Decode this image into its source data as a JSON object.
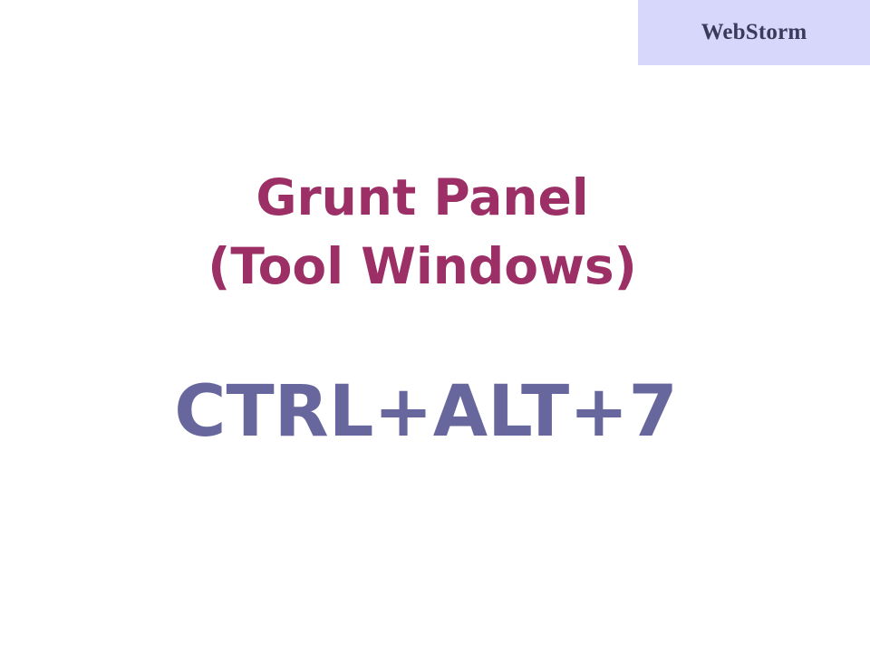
{
  "brand": {
    "label": "WebStorm"
  },
  "slide": {
    "title_line1": "Grunt Panel",
    "title_line2": "(Tool Windows)",
    "shortcut": "CTRL+ALT+7"
  },
  "colors": {
    "brand_background": "#d7d7fb",
    "title": "#9b2f66",
    "shortcut": "#67679e"
  }
}
